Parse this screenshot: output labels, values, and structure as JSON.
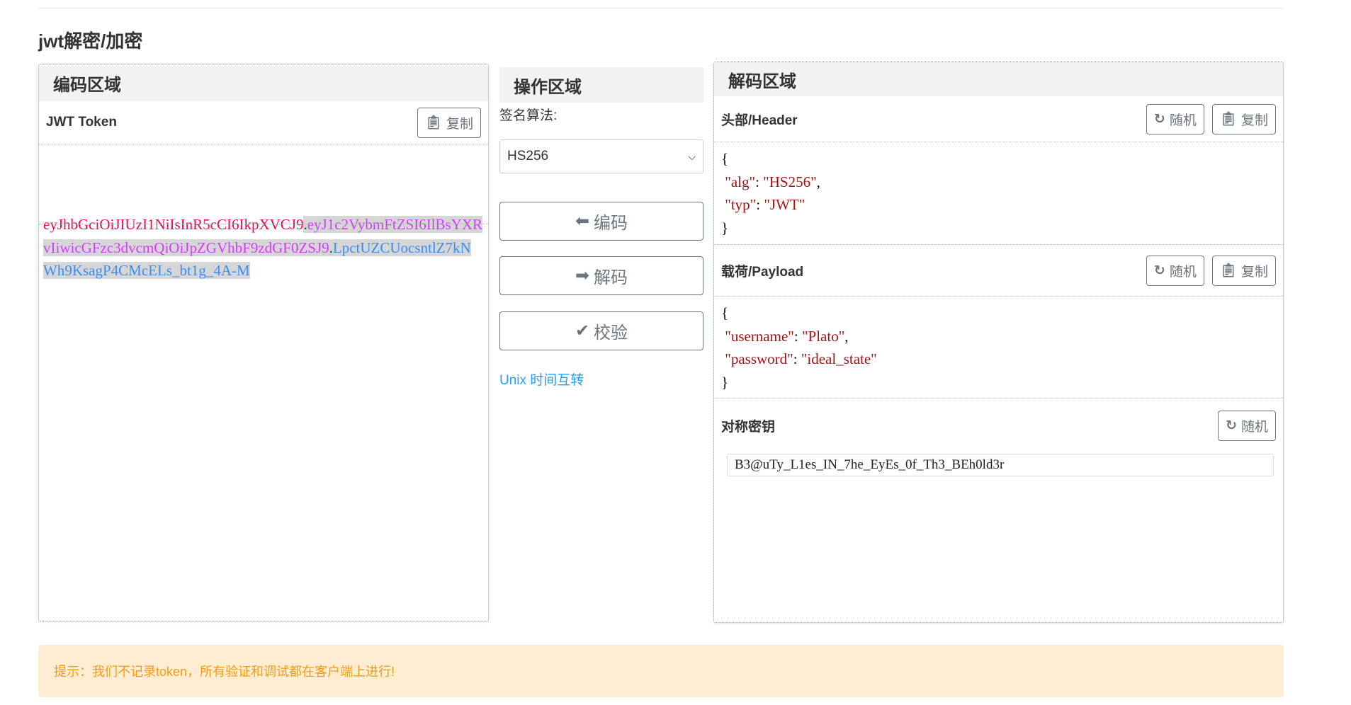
{
  "page_title": "jwt解密/加密",
  "encode_panel": {
    "title": "编码区域",
    "token_label": "JWT Token",
    "copy_label": "复制",
    "token_header": "eyJhbGciOiJIUzI1NiIsInR5cCI6IkpXVCJ9",
    "token_payload": "eyJ1c2VybmFtZSI6IlBsYXRvIiwicGFzc3dvcmQiOiJpZGVhbF9zdGF0ZSJ9",
    "token_signature": "LpctUZCUocsntlZ7kNWh9KsagP4CMcELs_bt1g_4A-M",
    "dot": "."
  },
  "operation_panel": {
    "title": "操作区域",
    "algorithm_label": "签名算法:",
    "algorithm_value": "HS256",
    "encode_label": "编码",
    "decode_label": "解码",
    "verify_label": "校验",
    "unix_link": "Unix 时间互转"
  },
  "decode_panel": {
    "title": "解码区域",
    "header_label": "头部/Header",
    "payload_label": "载荷/Payload",
    "secret_label": "对称密钥",
    "random_label": "随机",
    "copy_label": "复制",
    "header_json": {
      "open": "{",
      "close": "}",
      "line1_key": "\"alg\"",
      "line1_val": "\"HS256\"",
      "line1_end": ",",
      "line2_key": "\"typ\"",
      "line2_val": "\"JWT\""
    },
    "payload_json": {
      "open": "{",
      "close": "}",
      "line1_key": "\"username\"",
      "line1_val": "\"Plato\"",
      "line1_end": ",",
      "line2_key": "\"password\"",
      "line2_val": "\"ideal_state\""
    },
    "secret_value": "B3@uTy_L1es_IN_7he_EyEs_0f_Th3_BEh0ld3r"
  },
  "tip": "提示：我们不记录token，所有验证和调试都在客户端上进行!",
  "colors": {
    "token_header": "#fb015b",
    "token_payload": "#d63aff",
    "token_signature": "#00b9f1",
    "tip_bg": "#feedd3",
    "tip_text": "#f39c12",
    "link": "#1e9fff"
  }
}
